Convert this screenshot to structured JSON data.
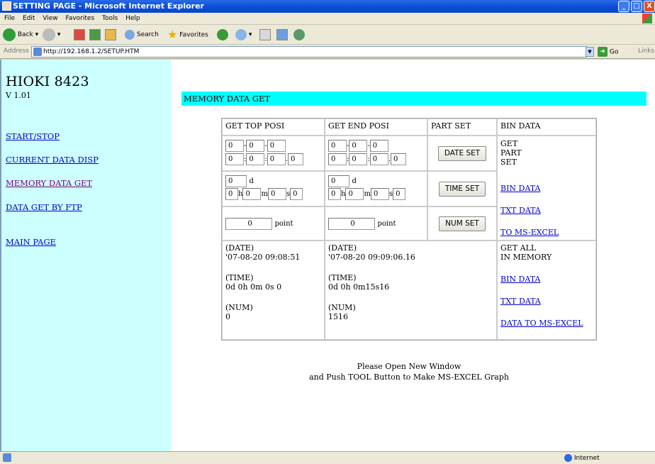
{
  "window": {
    "title": "SETTING PAGE - Microsoft Internet Explorer",
    "buttons": [
      "_",
      "□",
      "X"
    ]
  },
  "menu": [
    "File",
    "Edit",
    "View",
    "Favorites",
    "Tools",
    "Help"
  ],
  "toolbar": {
    "back": "Back",
    "search": "Search",
    "favorites": "Favorites"
  },
  "address": {
    "label": "Address",
    "url": "http://192.168.1.2/SETUP.HTM",
    "go": "Go",
    "links": "Links"
  },
  "sidebar": {
    "brand": "HIOKI 8423",
    "version": "V 1.01",
    "links": [
      "START/STOP",
      "CURRENT DATA DISP",
      "MEMORY DATA GET",
      "DATA GET BY FTP",
      "MAIN PAGE"
    ]
  },
  "main": {
    "header": "MEMORY DATA GET",
    "columns": [
      "GET TOP POSI",
      "GET END POSI",
      "PART SET",
      "BIN DATA"
    ],
    "top_date": [
      "0",
      "0",
      "0",
      "0",
      "0",
      "0",
      "0"
    ],
    "end_date": [
      "0",
      "0",
      "0",
      "0",
      "0",
      "0",
      "0"
    ],
    "top_time": {
      "d": "0",
      "h": "0",
      "m": "0",
      "s": "0"
    },
    "end_time": {
      "d": "0",
      "h": "0",
      "m": "0",
      "s": "0"
    },
    "units": {
      "d": "d",
      "h": "h",
      "m": "m",
      "s": "s",
      "point": "point"
    },
    "top_point": "0",
    "end_point": "0",
    "buttons": {
      "date_set": "DATE SET",
      "time_set": "TIME SET",
      "num_set": "NUM SET"
    },
    "part_lines": [
      "GET",
      "PART",
      "SET"
    ],
    "bin_links": [
      "BIN DATA",
      "TXT DATA",
      "TO MS-EXCEL"
    ],
    "top_result": {
      "date_label": "(DATE)",
      "date": "'07-08-20 09:08:51",
      "time_label": "(TIME)",
      "time": "0d 0h 0m 0s 0",
      "num_label": "(NUM)",
      "num": "0"
    },
    "end_result": {
      "date_label": "(DATE)",
      "date": "'07-08-20 09:09:06.16",
      "time_label": "(TIME)",
      "time": "0d 0h 0m15s16",
      "num_label": "(NUM)",
      "num": "1516"
    },
    "all_lines": [
      "GET ALL",
      "IN MEMORY"
    ],
    "all_links": [
      "BIN DATA",
      "TXT DATA",
      "DATA TO MS-EXCEL"
    ],
    "note_line1": "Please Open New Window",
    "note_line2": "and Push TOOL Button to Make MS-EXCEL Graph"
  },
  "status": {
    "zone": "Internet"
  }
}
